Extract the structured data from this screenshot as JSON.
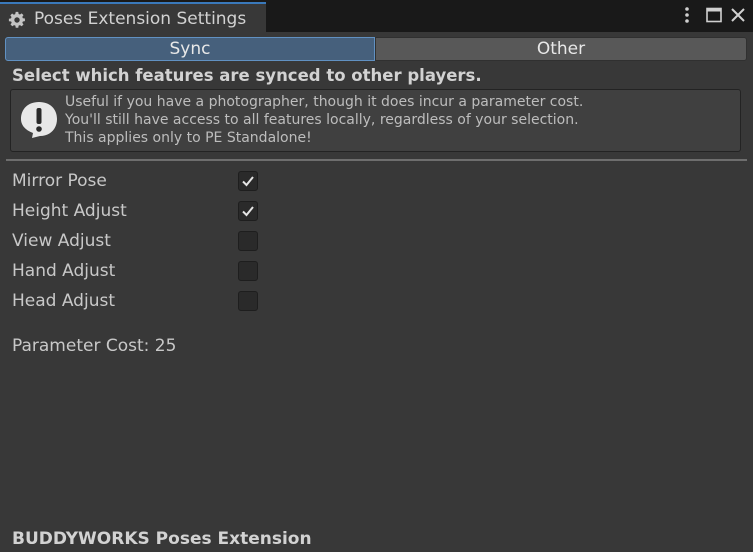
{
  "window": {
    "title": "Poses Extension Settings",
    "tab_icon": "gear-icon",
    "controls": [
      "kebab-menu-icon",
      "maximize-icon",
      "close-icon"
    ]
  },
  "toolbar": {
    "tabs": [
      {
        "label": "Sync",
        "selected": true
      },
      {
        "label": "Other",
        "selected": false
      }
    ]
  },
  "sync": {
    "heading": "Select which features are synced to other players.",
    "help": {
      "icon": "warning-icon",
      "lines": [
        "Useful if you have a photographer, though it does incur a parameter cost.",
        "You'll still have access to all features locally, regardless of your selection.",
        "This applies only to PE Standalone!"
      ]
    },
    "features": [
      {
        "label": "Mirror Pose",
        "checked": true
      },
      {
        "label": "Height Adjust",
        "checked": true
      },
      {
        "label": "View Adjust",
        "checked": false
      },
      {
        "label": "Hand Adjust",
        "checked": false
      },
      {
        "label": "Head Adjust",
        "checked": false
      }
    ],
    "parameter_cost": "Parameter Cost: 25"
  },
  "footer": {
    "label": "BUDDYWORKS Poses Extension"
  },
  "colors": {
    "window_bg": "#383838",
    "titlebar_bg": "#191919",
    "selected_tab": "#46607c",
    "accent": "#3a79bb"
  }
}
